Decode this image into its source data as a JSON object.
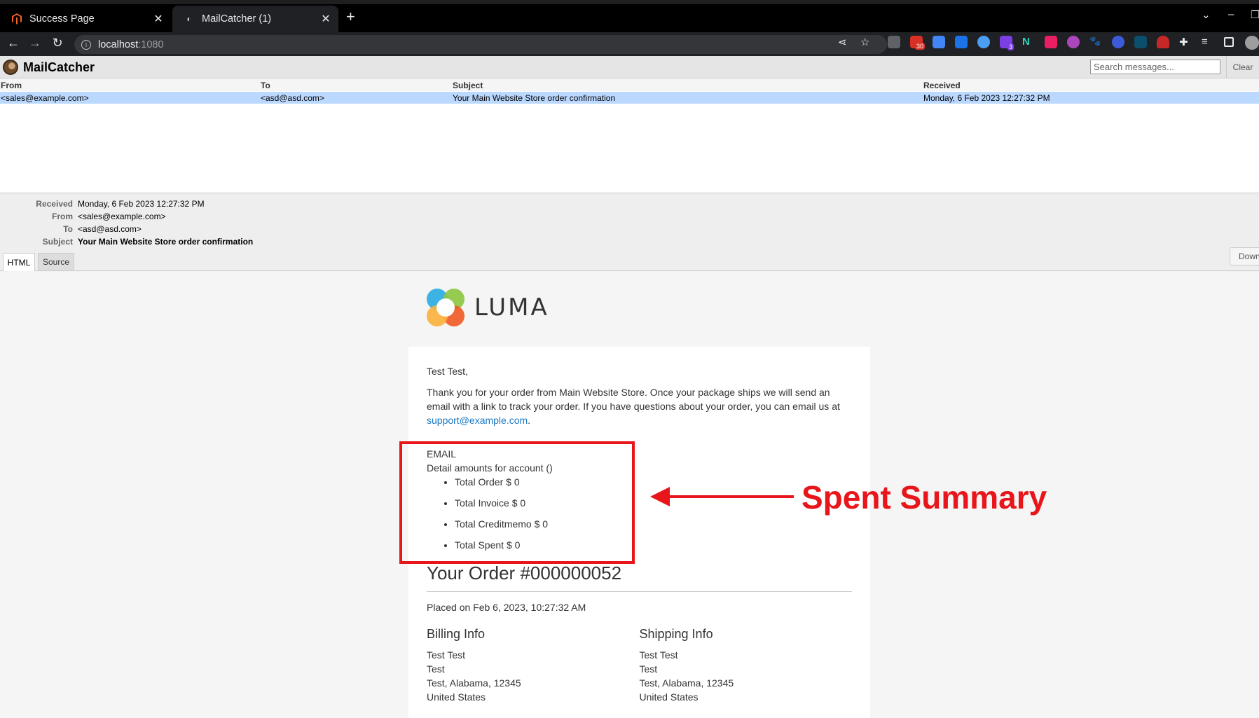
{
  "browser": {
    "tabs": [
      {
        "title": "Success Page",
        "favicon": "magento-icon",
        "active": false
      },
      {
        "title": "MailCatcher (1)",
        "favicon": "mailcatcher-icon",
        "active": true
      }
    ],
    "url_host": "localhost",
    "url_port": ":1080",
    "extension_badges": {
      "mail": "30",
      "puzzle": "3"
    }
  },
  "mailcatcher": {
    "title": "MailCatcher",
    "search_placeholder": "Search messages...",
    "clear_label": "Clear",
    "columns": [
      "From",
      "To",
      "Subject",
      "Received"
    ],
    "messages": [
      {
        "from": "<sales@example.com>",
        "to": "<asd@asd.com>",
        "subject": "Your Main Website Store order confirmation",
        "received": "Monday, 6 Feb 2023 12:27:32 PM"
      }
    ],
    "meta": {
      "received_label": "Received",
      "received": "Monday, 6 Feb 2023 12:27:32 PM",
      "from_label": "From",
      "from": "<sales@example.com>",
      "to_label": "To",
      "to": "<asd@asd.com>",
      "subject_label": "Subject",
      "subject": "Your Main Website Store order confirmation"
    },
    "format_tabs": {
      "html": "HTML",
      "source": "Source"
    },
    "download_label": "Down"
  },
  "email": {
    "brand": "LUMA",
    "greeting": "Test Test,",
    "intro": "Thank you for your order from Main Website Store. Once your package ships we will send an email with a link to track your order. If you have questions about your order, you can email us at ",
    "support_email": "support@example.com",
    "intro_end": ".",
    "spend": {
      "heading": "EMAIL",
      "subheading": "Detail amounts for account ()",
      "items": [
        "Total Order $ 0",
        "Total Invoice $ 0",
        "Total Creditmemo $ 0",
        "Total Spent $ 0"
      ]
    },
    "order_title": "Your Order #000000052",
    "placed": "Placed on Feb 6, 2023, 10:27:32 AM",
    "billing": {
      "heading": "Billing Info",
      "lines": [
        "Test Test",
        "Test",
        "Test, Alabama, 12345",
        "United States"
      ]
    },
    "shipping": {
      "heading": "Shipping Info",
      "lines": [
        "Test Test",
        "Test",
        "Test, Alabama, 12345",
        "United States"
      ]
    }
  },
  "annotation": {
    "label": "Spent Summary",
    "color": "#e8161a"
  }
}
